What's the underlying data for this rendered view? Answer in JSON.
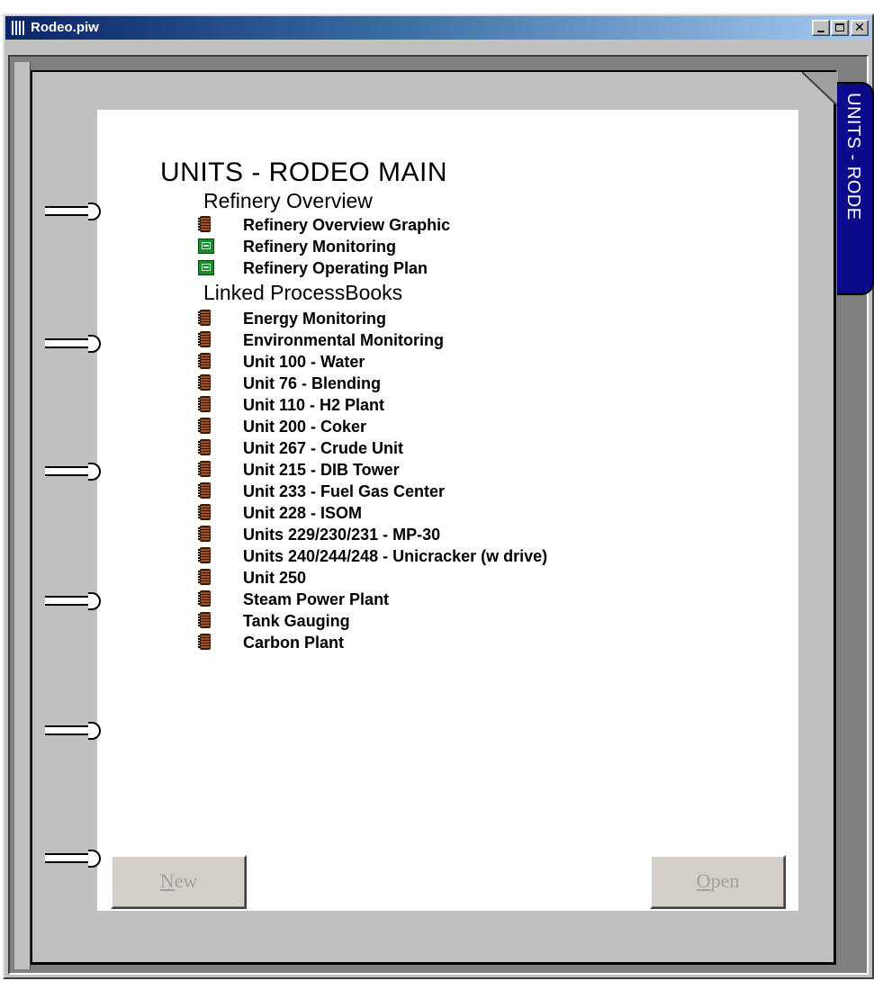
{
  "window": {
    "title": "Rodeo.piw"
  },
  "side_tab": {
    "label": "UNITS - RODE"
  },
  "page": {
    "heading": "UNITS - RODEO MAIN",
    "sections": [
      {
        "title": "Refinery Overview",
        "items": [
          {
            "label": "Refinery Overview Graphic",
            "icon": "book-icon"
          },
          {
            "label": "Refinery Monitoring",
            "icon": "display-icon"
          },
          {
            "label": "Refinery Operating Plan",
            "icon": "display-icon"
          }
        ]
      },
      {
        "title": "Linked ProcessBooks",
        "items": [
          {
            "label": "Energy Monitoring",
            "icon": "book-icon"
          },
          {
            "label": "Environmental Monitoring",
            "icon": "book-icon"
          },
          {
            "label": "Unit 100 - Water",
            "icon": "book-icon"
          },
          {
            "label": "Unit 76 - Blending",
            "icon": "book-icon"
          },
          {
            "label": "Unit 110 - H2 Plant",
            "icon": "book-icon"
          },
          {
            "label": "Unit 200 - Coker",
            "icon": "book-icon"
          },
          {
            "label": "Unit 267 - Crude Unit",
            "icon": "book-icon"
          },
          {
            "label": "Unit 215 - DIB Tower",
            "icon": "book-icon"
          },
          {
            "label": "Unit 233 - Fuel Gas Center",
            "icon": "book-icon"
          },
          {
            "label": "Unit 228 - ISOM",
            "icon": "book-icon"
          },
          {
            "label": "Units 229/230/231 - MP-30",
            "icon": "book-icon"
          },
          {
            "label": "Units 240/244/248 - Unicracker (w drive)",
            "icon": "book-icon"
          },
          {
            "label": "Unit 250",
            "icon": "book-icon"
          },
          {
            "label": "Steam Power Plant",
            "icon": "book-icon"
          },
          {
            "label": "Tank Gauging",
            "icon": "book-icon"
          },
          {
            "label": "Carbon Plant",
            "icon": "book-icon"
          }
        ]
      }
    ]
  },
  "buttons": {
    "new": {
      "mnemonic": "N",
      "rest": "ew"
    },
    "open": {
      "mnemonic": "O",
      "rest": "pen"
    }
  },
  "colors": {
    "title_gradient_start": "#0a246a",
    "tab_background": "#0a0a8a",
    "book_icon": "#a0522d",
    "display_icon": "#1a8a2a"
  }
}
